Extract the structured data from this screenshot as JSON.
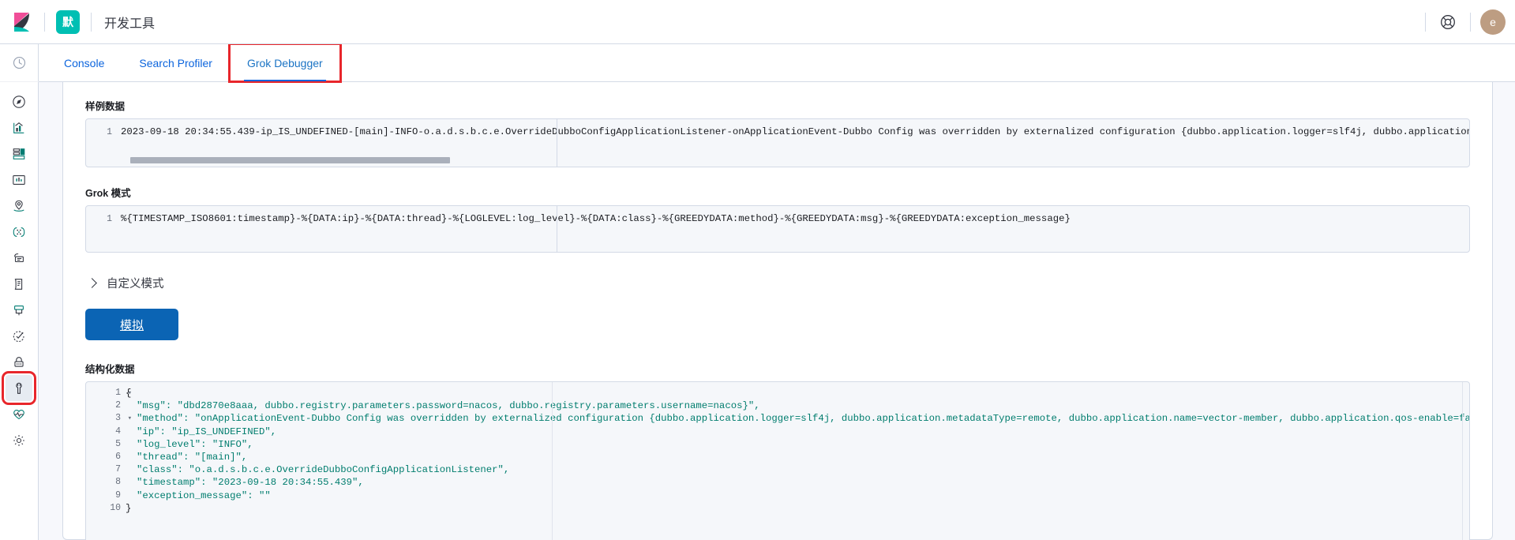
{
  "header": {
    "logo_icon": "kibana-logo",
    "space_badge": "默",
    "title": "开发工具",
    "help_icon": "lifebuoy-help-icon",
    "avatar_initial": "e"
  },
  "sidebar": {
    "recent_icon": "clock-recent-icon",
    "items": [
      {
        "icon": "discover-compass-icon",
        "name": "sidebar-item-discover"
      },
      {
        "icon": "visualize-chart-icon",
        "name": "sidebar-item-visualize"
      },
      {
        "icon": "dashboard-grid-icon",
        "name": "sidebar-item-dashboard"
      },
      {
        "icon": "canvas-icon",
        "name": "sidebar-item-canvas"
      },
      {
        "icon": "maps-location-icon",
        "name": "sidebar-item-maps"
      },
      {
        "icon": "machine-learning-icon",
        "name": "sidebar-item-machine-learning"
      },
      {
        "icon": "apm-layers-icon",
        "name": "sidebar-item-apm"
      },
      {
        "icon": "logs-document-icon",
        "name": "sidebar-item-logs"
      },
      {
        "icon": "infrastructure-monitor-icon",
        "name": "sidebar-item-infrastructure"
      },
      {
        "icon": "uptime-check-icon",
        "name": "sidebar-item-uptime"
      },
      {
        "icon": "security-lock-icon",
        "name": "sidebar-item-security"
      },
      {
        "icon": "dev-tools-wrench-icon",
        "name": "sidebar-item-dev-tools"
      },
      {
        "icon": "stack-monitoring-heart-icon",
        "name": "sidebar-item-stack-monitoring"
      },
      {
        "icon": "management-gear-icon",
        "name": "sidebar-item-management"
      }
    ],
    "selected_index": 11
  },
  "tabs": [
    {
      "label": "Console",
      "active": false
    },
    {
      "label": "Search Profiler",
      "active": false
    },
    {
      "label": "Grok Debugger",
      "active": true
    }
  ],
  "main": {
    "sample_data": {
      "label": "样例数据",
      "line_number": "1",
      "value": "2023-09-18 20:34:55.439-ip_IS_UNDEFINED-[main]-INFO-o.a.d.s.b.c.e.OverrideDubboConfigApplicationListener-onApplicationEvent-Dubbo Config was overridden by externalized configuration {dubbo.application.logger=slf4j, dubbo.application.metadataType=remote, dubbo.appl"
    },
    "grok_pattern": {
      "label": "Grok 模式",
      "line_number": "1",
      "value": "%{TIMESTAMP_ISO8601:timestamp}-%{DATA:ip}-%{DATA:thread}-%{LOGLEVEL:log_level}-%{DATA:class}-%{GREEDYDATA:method}-%{GREEDYDATA:msg}-%{GREEDYDATA:exception_message}"
    },
    "custom_patterns": {
      "label": "自定义模式",
      "expanded": false,
      "chevron_icon": "chevron-right-icon"
    },
    "simulate_button": {
      "label": "模拟"
    },
    "structured_data": {
      "label": "结构化数据",
      "lines": [
        {
          "num": "1",
          "fold": true,
          "text": "{",
          "indent": false
        },
        {
          "num": "2",
          "fold": false,
          "text": "\"msg\": \"dbd2870e8aaa, dubbo.registry.parameters.password=nacos, dubbo.registry.parameters.username=nacos}\",",
          "indent": true
        },
        {
          "num": "3",
          "fold": true,
          "text": "\"method\": \"onApplicationEvent-Dubbo Config was overridden by externalized configuration {dubbo.application.logger=slf4j, dubbo.application.metadataType=remote, dubbo.application.name=vector-member, dubbo.application.qos-enable=false, dubbo.config.multiple=true,",
          "indent": true
        },
        {
          "num": "4",
          "fold": false,
          "text": "\"ip\": \"ip_IS_UNDEFINED\",",
          "indent": true
        },
        {
          "num": "5",
          "fold": false,
          "text": "\"log_level\": \"INFO\",",
          "indent": true
        },
        {
          "num": "6",
          "fold": false,
          "text": "\"thread\": \"[main]\",",
          "indent": true
        },
        {
          "num": "7",
          "fold": false,
          "text": "\"class\": \"o.a.d.s.b.c.e.OverrideDubboConfigApplicationListener\",",
          "indent": true
        },
        {
          "num": "8",
          "fold": false,
          "text": "\"timestamp\": \"2023-09-18 20:34:55.439\",",
          "indent": true
        },
        {
          "num": "9",
          "fold": false,
          "text": "\"exception_message\": \"\"",
          "indent": true
        },
        {
          "num": "10",
          "fold": false,
          "text": "}",
          "indent": false
        }
      ]
    }
  },
  "colors": {
    "accent_blue": "#0b64dd",
    "button_blue": "#0b64b4",
    "teal": "#00bfb3",
    "highlight_red": "#e8262b",
    "json_green": "#007d6e",
    "avatar_tan": "#bd9d82"
  }
}
